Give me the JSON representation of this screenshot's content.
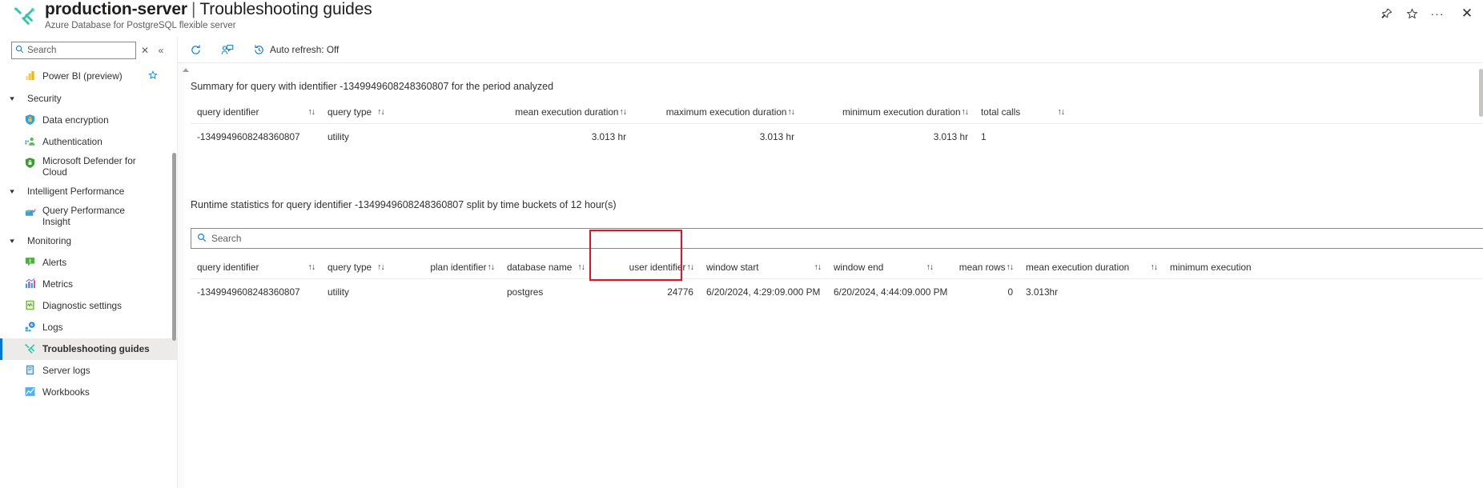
{
  "header": {
    "icon": "troubleshooting-wrench-screwdriver-icon",
    "resource_name": "production-server",
    "separator": "|",
    "page_name": "Troubleshooting guides",
    "subtitle": "Azure Database for PostgreSQL flexible server",
    "actions": [
      {
        "name": "pin-icon",
        "glyph": "📌"
      },
      {
        "name": "favorite-star-icon",
        "glyph": "☆"
      },
      {
        "name": "more-options-icon",
        "glyph": "···"
      }
    ],
    "close_label": "✕"
  },
  "sidebar": {
    "search": {
      "placeholder": "Search",
      "value": "",
      "icon": "search-icon"
    },
    "clear_icon": "close-icon",
    "collapse_icon": "collapse-chevrons-icon",
    "items": [
      {
        "type": "item",
        "label": "Power BI (preview)",
        "icon": "power-bi-icon",
        "favorite": true,
        "selected": false
      },
      {
        "type": "group",
        "label": "Security",
        "expanded": true
      },
      {
        "type": "item",
        "label": "Data encryption",
        "icon": "shield-lock-icon",
        "selected": false
      },
      {
        "type": "item",
        "label": "Authentication",
        "icon": "authentication-users-icon",
        "selected": false
      },
      {
        "type": "item",
        "label": "Microsoft Defender for Cloud",
        "icon": "defender-shield-icon",
        "selected": false,
        "two_line": true
      },
      {
        "type": "group",
        "label": "Intelligent Performance",
        "expanded": true
      },
      {
        "type": "item",
        "label": "Query Performance Insight",
        "icon": "query-performance-icon",
        "selected": false,
        "two_line": true
      },
      {
        "type": "group",
        "label": "Monitoring",
        "expanded": true
      },
      {
        "type": "item",
        "label": "Alerts",
        "icon": "alerts-icon",
        "selected": false
      },
      {
        "type": "item",
        "label": "Metrics",
        "icon": "metrics-chart-icon",
        "selected": false
      },
      {
        "type": "item",
        "label": "Diagnostic settings",
        "icon": "diagnostic-settings-icon",
        "selected": false
      },
      {
        "type": "item",
        "label": "Logs",
        "icon": "logs-icon",
        "selected": false
      },
      {
        "type": "item",
        "label": "Troubleshooting guides",
        "icon": "troubleshooting-icon",
        "selected": true
      },
      {
        "type": "item",
        "label": "Server logs",
        "icon": "server-logs-book-icon",
        "selected": false
      },
      {
        "type": "item",
        "label": "Workbooks",
        "icon": "workbooks-icon",
        "selected": false
      }
    ]
  },
  "command_bar": {
    "refresh": {
      "label": "",
      "icon": "refresh-icon"
    },
    "feedback": {
      "label": "",
      "icon": "feedback-person-icon"
    },
    "auto_refresh": {
      "label": "Auto refresh: Off",
      "icon": "clock-history-icon"
    }
  },
  "summary_section": {
    "title": "Summary for query with identifier -1349949608248360807 for the period analyzed",
    "columns": [
      {
        "label": "query identifier",
        "sortable": true,
        "align": "left",
        "sort_gap": "wide"
      },
      {
        "label": "query type",
        "sortable": true,
        "align": "left",
        "sort_gap": "narrow"
      },
      {
        "label": "mean execution duration",
        "sortable": true,
        "align": "right",
        "sort_gap": "none"
      },
      {
        "label": "maximum execution duration",
        "sortable": true,
        "align": "right",
        "sort_gap": "none"
      },
      {
        "label": "minimum execution duration",
        "sortable": true,
        "align": "right",
        "sort_gap": "none"
      },
      {
        "label": "total calls",
        "sortable": true,
        "align": "left",
        "sort_gap": "wide"
      }
    ],
    "rows": [
      {
        "query_identifier": "-1349949608248360807",
        "query_type": "utility",
        "mean_execution_duration": "3.013 hr",
        "maximum_execution_duration": "3.013 hr",
        "minimum_execution_duration": "3.013 hr",
        "total_calls": "1"
      }
    ]
  },
  "runtime_section": {
    "title": "Runtime statistics for query identifier -1349949608248360807 split by time buckets of 12 hour(s)",
    "download_icon": "download-icon",
    "search": {
      "placeholder": "Search",
      "value": "",
      "icon": "search-icon"
    },
    "columns": [
      {
        "label": "query identifier",
        "sortable": true,
        "align": "left",
        "sort_gap": "wide"
      },
      {
        "label": "query type",
        "sortable": true,
        "align": "left",
        "sort_gap": "narrow"
      },
      {
        "label": "plan identifier",
        "sortable": true,
        "align": "right",
        "sort_gap": "none"
      },
      {
        "label": "database name",
        "sortable": true,
        "align": "left",
        "sort_gap": "narrow"
      },
      {
        "label": "user identifier",
        "sortable": true,
        "align": "right",
        "sort_gap": "none",
        "highlighted": true
      },
      {
        "label": "window start",
        "sortable": true,
        "align": "left",
        "sort_gap": "wide"
      },
      {
        "label": "window end",
        "sortable": true,
        "align": "left",
        "sort_gap": "wide"
      },
      {
        "label": "mean rows",
        "sortable": true,
        "align": "right",
        "sort_gap": "none"
      },
      {
        "label": "mean execution duration",
        "sortable": true,
        "align": "left",
        "sort_gap": "wide"
      },
      {
        "label": "minimum execution",
        "sortable": false,
        "align": "left",
        "sort_gap": "none",
        "truncated": true
      }
    ],
    "rows": [
      {
        "query_identifier": "-1349949608248360807",
        "query_type": "utility",
        "plan_identifier": "",
        "database_name": "postgres",
        "user_identifier": "24776",
        "window_start": "6/20/2024, 4:29:09.000 PM",
        "window_end": "6/20/2024, 4:44:09.000 PM",
        "mean_rows": "0",
        "mean_execution_duration": "3.013hr",
        "minimum_execution": ""
      }
    ]
  },
  "annotation": {
    "highlight_color": "#e81123",
    "highlight_target": "user identifier"
  }
}
